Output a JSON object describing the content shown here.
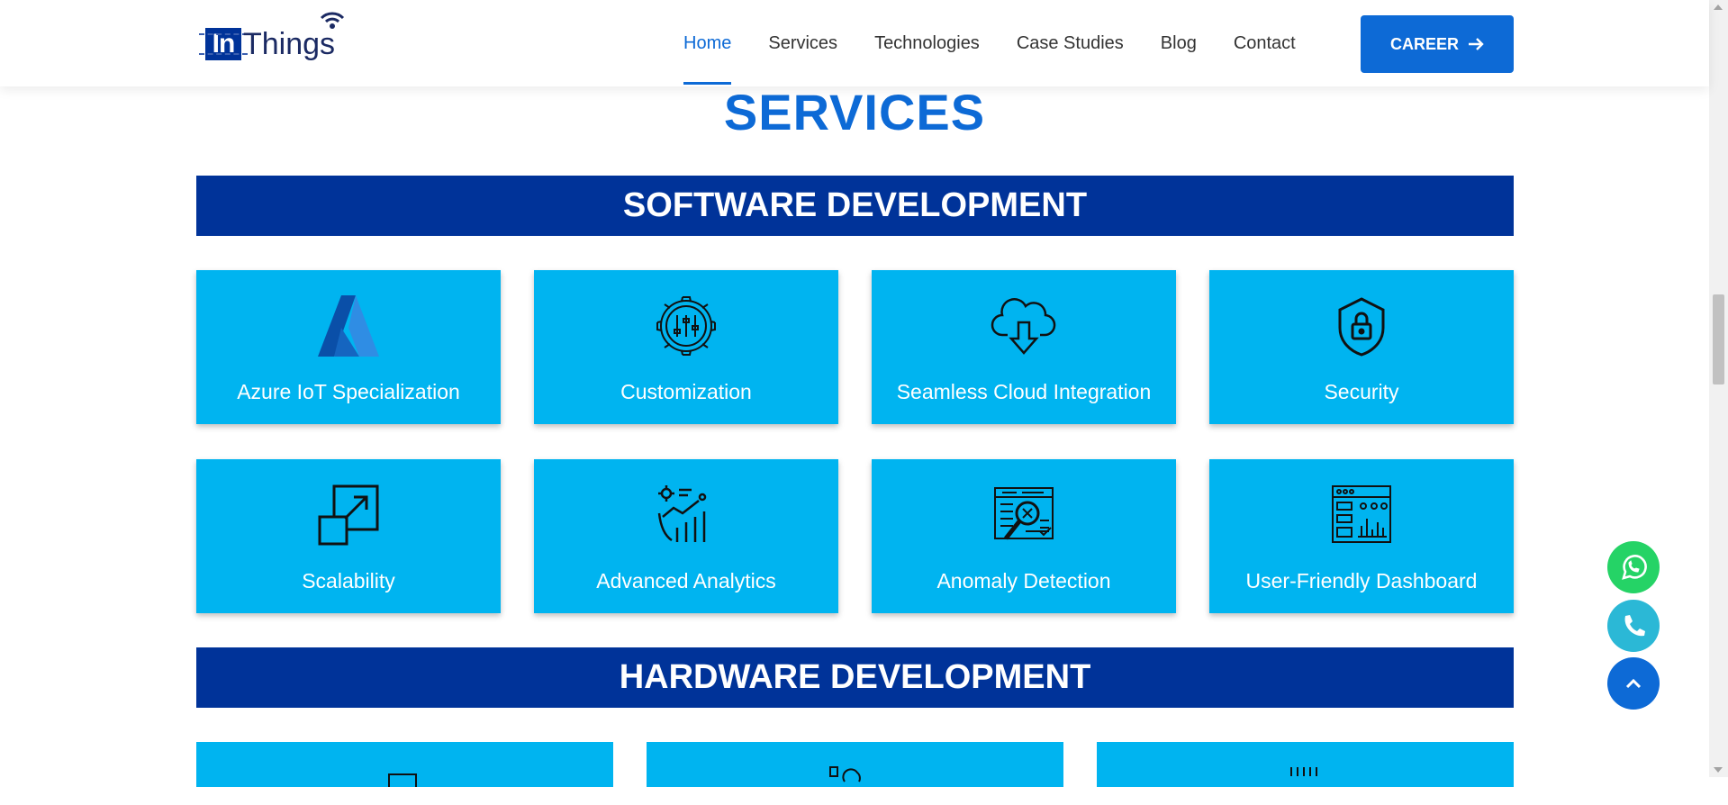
{
  "logo": {
    "box_text": "In",
    "rest_text": "Things"
  },
  "nav": [
    {
      "label": "Home",
      "active": true
    },
    {
      "label": "Services",
      "active": false
    },
    {
      "label": "Technologies",
      "active": false
    },
    {
      "label": "Case Studies",
      "active": false
    },
    {
      "label": "Blog",
      "active": false
    },
    {
      "label": "Contact",
      "active": false
    }
  ],
  "career_label": "CAREER",
  "page_title": "SERVICES",
  "software": {
    "heading": "SOFTWARE DEVELOPMENT",
    "cards": [
      {
        "label": "Azure IoT Specialization",
        "icon": "azure-icon"
      },
      {
        "label": "Customization",
        "icon": "gear-sliders-icon"
      },
      {
        "label": "Seamless Cloud Integration",
        "icon": "cloud-download-icon"
      },
      {
        "label": "Security",
        "icon": "shield-lock-icon"
      },
      {
        "label": "Scalability",
        "icon": "scale-arrow-icon"
      },
      {
        "label": "Advanced Analytics",
        "icon": "analytics-icon"
      },
      {
        "label": "Anomaly Detection",
        "icon": "anomaly-search-icon"
      },
      {
        "label": "User-Friendly Dashboard",
        "icon": "dashboard-icon"
      }
    ]
  },
  "hardware": {
    "heading": "HARDWARE DEVELOPMENT"
  },
  "colors": {
    "primary": "#0d6ad6",
    "band": "#003399",
    "card": "#00b4f0",
    "whatsapp": "#25d366",
    "phone": "#2bb8d6"
  }
}
